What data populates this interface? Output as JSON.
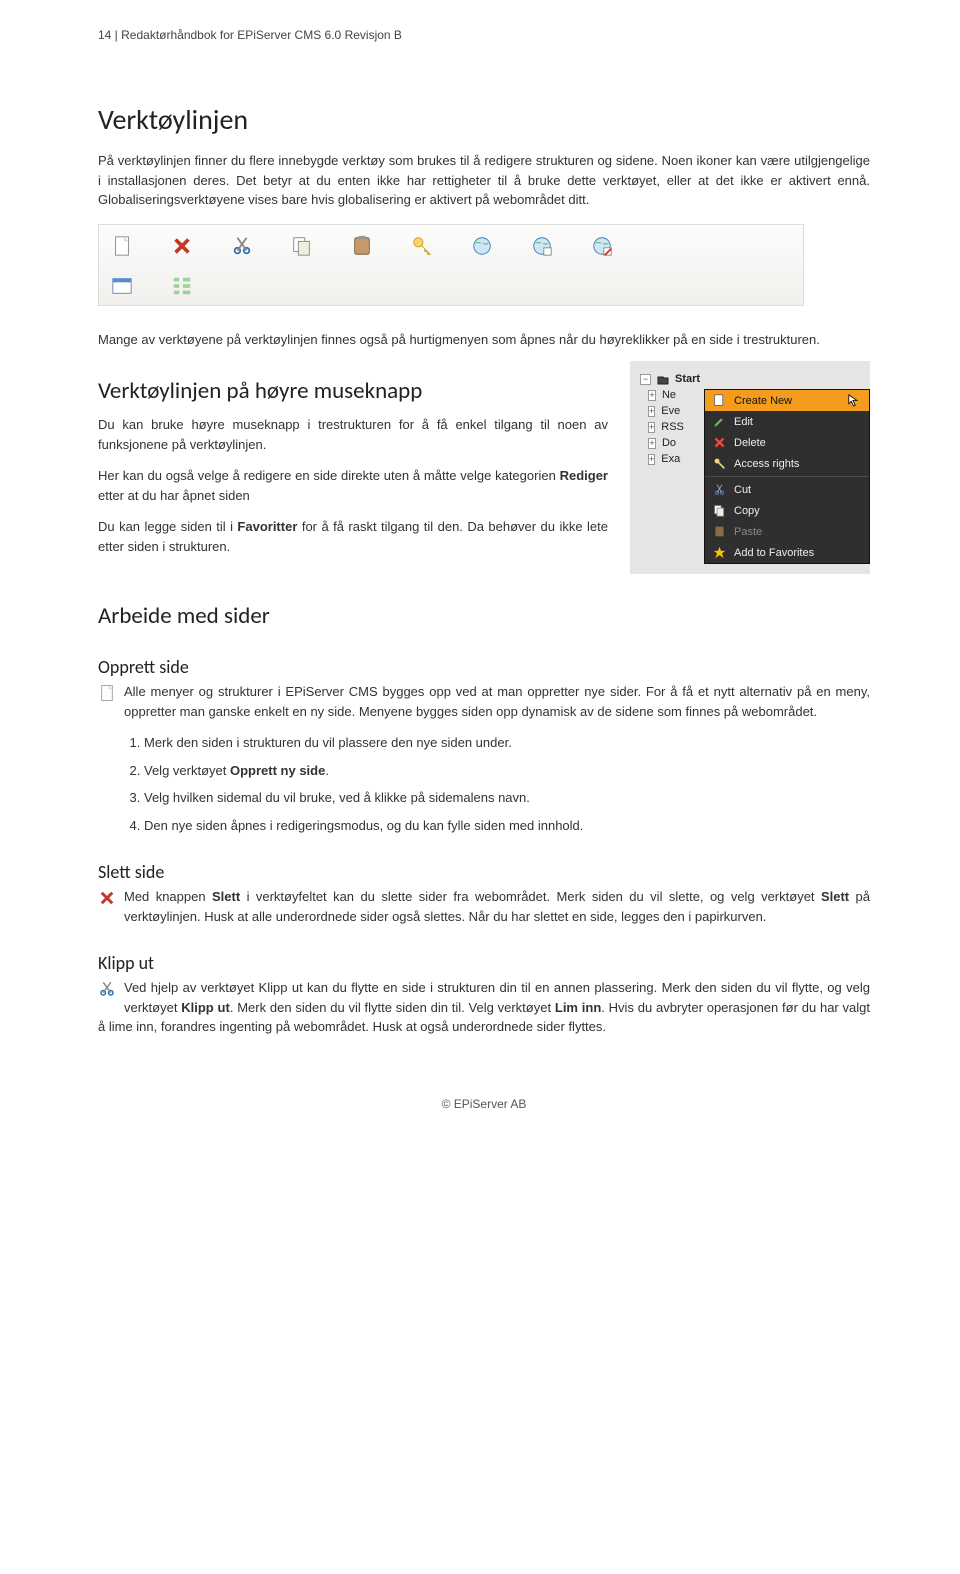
{
  "header": "14 | Redaktørhåndbok for EPiServer CMS 6.0 Revisjon B",
  "section1": {
    "title": "Verktøylinjen",
    "p1": "På verktøylinjen finner du flere innebygde verktøy som brukes til å redigere strukturen og sidene. Noen ikoner kan være utilgjengelige i installasjonen deres. Det betyr at du enten ikke har rettigheter til å bruke dette verktøyet, eller at det ikke er aktivert ennå. Globaliseringsverktøyene vises bare hvis globalisering er aktivert på webområdet ditt.",
    "p2": "Mange av verktøyene på verktøylinjen finnes også på hurtigmenyen som åpnes når du høyreklikker på en side i trestrukturen."
  },
  "toolbar_icons": {
    "row1": [
      "new-page-icon",
      "delete-icon",
      "cut-icon",
      "copy-icon",
      "paste-icon",
      "permissions-icon",
      "globe1-icon",
      "globe2-icon",
      "globe3-icon"
    ],
    "row2": [
      "favorite-list-icon",
      "tree-view-icon"
    ]
  },
  "section2": {
    "title": "Verktøylinjen på høyre museknapp",
    "p1": "Du kan bruke høyre museknapp i trestrukturen for å få enkel tilgang til noen av funksjonene på verktøylinjen.",
    "p2_a": "Her kan du også velge å redigere en side direkte uten å måtte velge kategorien ",
    "p2_b": "Rediger",
    "p2_c": " etter at du har åpnet siden",
    "p3_a": "Du kan legge siden til i ",
    "p3_b": "Favoritter",
    "p3_c": " for å få raskt tilgang til den. Da behøver du ikke lete etter siden i strukturen."
  },
  "contextmenu": {
    "root": "Start",
    "tree_items": [
      "Ne",
      "Eve",
      "RSS",
      "Do",
      "Exa"
    ],
    "items": [
      {
        "icon": "new",
        "label": "Create New",
        "selected": true
      },
      {
        "icon": "edit",
        "label": "Edit"
      },
      {
        "icon": "delete",
        "label": "Delete"
      },
      {
        "icon": "access",
        "label": "Access rights"
      },
      {
        "sep": true
      },
      {
        "icon": "cut",
        "label": "Cut"
      },
      {
        "icon": "copy",
        "label": "Copy"
      },
      {
        "icon": "paste",
        "label": "Paste",
        "disabled": true
      },
      {
        "icon": "fav",
        "label": "Add to Favorites"
      }
    ]
  },
  "section3": {
    "title": "Arbeide med sider",
    "sub1": {
      "title": "Opprett side",
      "p1": "Alle menyer og strukturer i EPiServer CMS bygges opp ved at man oppretter nye sider. For å få et nytt alternativ på en meny, oppretter man ganske enkelt en ny side. Menyene bygges siden opp dynamisk av de sidene som finnes på webområdet.",
      "ol": [
        "Merk den siden i strukturen du vil plassere den nye siden under.",
        {
          "a": "Velg verktøyet ",
          "b": "Opprett ny side",
          "c": "."
        },
        "Velg hvilken sidemal du vil bruke, ved å klikke på sidemalens navn.",
        "Den nye siden åpnes i redigeringsmodus, og du kan fylle siden med innhold."
      ]
    },
    "sub2": {
      "title": "Slett side",
      "p1_a": "Med knappen ",
      "p1_b": "Slett",
      "p1_c": " i verktøyfeltet kan du slette sider fra webområdet. Merk siden du vil slette, og velg verktøyet ",
      "p1_d": "Slett",
      "p1_e": " på verktøylinjen. Husk at alle underordnede sider også slettes. Når du har slettet en side, legges den i papirkurven."
    },
    "sub3": {
      "title": "Klipp ut",
      "p1_a": "Ved hjelp av verktøyet Klipp ut kan du flytte en side i strukturen din til en annen plassering. Merk den siden du vil flytte, og velg verktøyet ",
      "p1_b": "Klipp ut",
      "p1_c": ". Merk den siden du vil flytte siden din til. Velg verktøyet ",
      "p1_d": "Lim inn",
      "p1_e": ". Hvis du avbryter operasjonen før du har valgt å lime inn, forandres ingenting på webområdet. Husk at også underordnede sider flyttes."
    }
  },
  "footer": "© EPiServer AB"
}
